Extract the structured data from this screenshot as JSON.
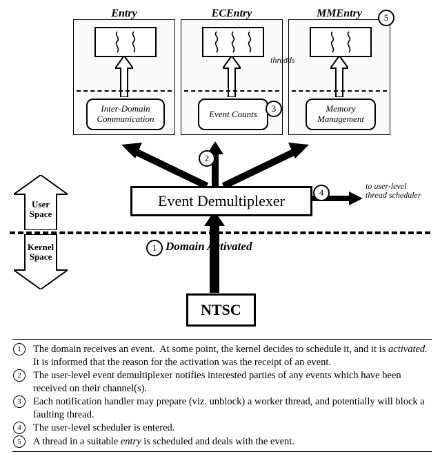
{
  "entries": {
    "a": {
      "title": "Entry",
      "handler": "Inter-Domain\nCommunication"
    },
    "b": {
      "title": "ECEntry",
      "handler": "Event Counts"
    },
    "c": {
      "title": "MMEntry",
      "handler": "Memory\nManagement"
    }
  },
  "threads_label": "threads",
  "demux_label": "Event Demultiplexer",
  "to_sched_l1": "to user-level",
  "to_sched_l2": "thread scheduler",
  "user_space": "User\nSpace",
  "kernel_space": "Kernel\nSpace",
  "domain_activated": "Domain Activated",
  "ntsc": "NTSC",
  "nums": {
    "n1": "1",
    "n2": "2",
    "n3": "3",
    "n4": "4",
    "n5": "5"
  },
  "legend": {
    "i1": "The domain receives an event.  At some point, the kernel decides to schedule it, and it is activated.  It is informed that the reason for the activation was the receipt of an event.",
    "i2": "The user-level event demultiplexer notifies interested parties of any events which have been received on their channel(s).",
    "i3": "Each notification handler may prepare (viz. unblock) a worker thread, and potentially will block a faulting thread.",
    "i4": "The user-level scheduler is entered.",
    "i5": "A thread in a suitable entry is scheduled and deals with the event."
  }
}
